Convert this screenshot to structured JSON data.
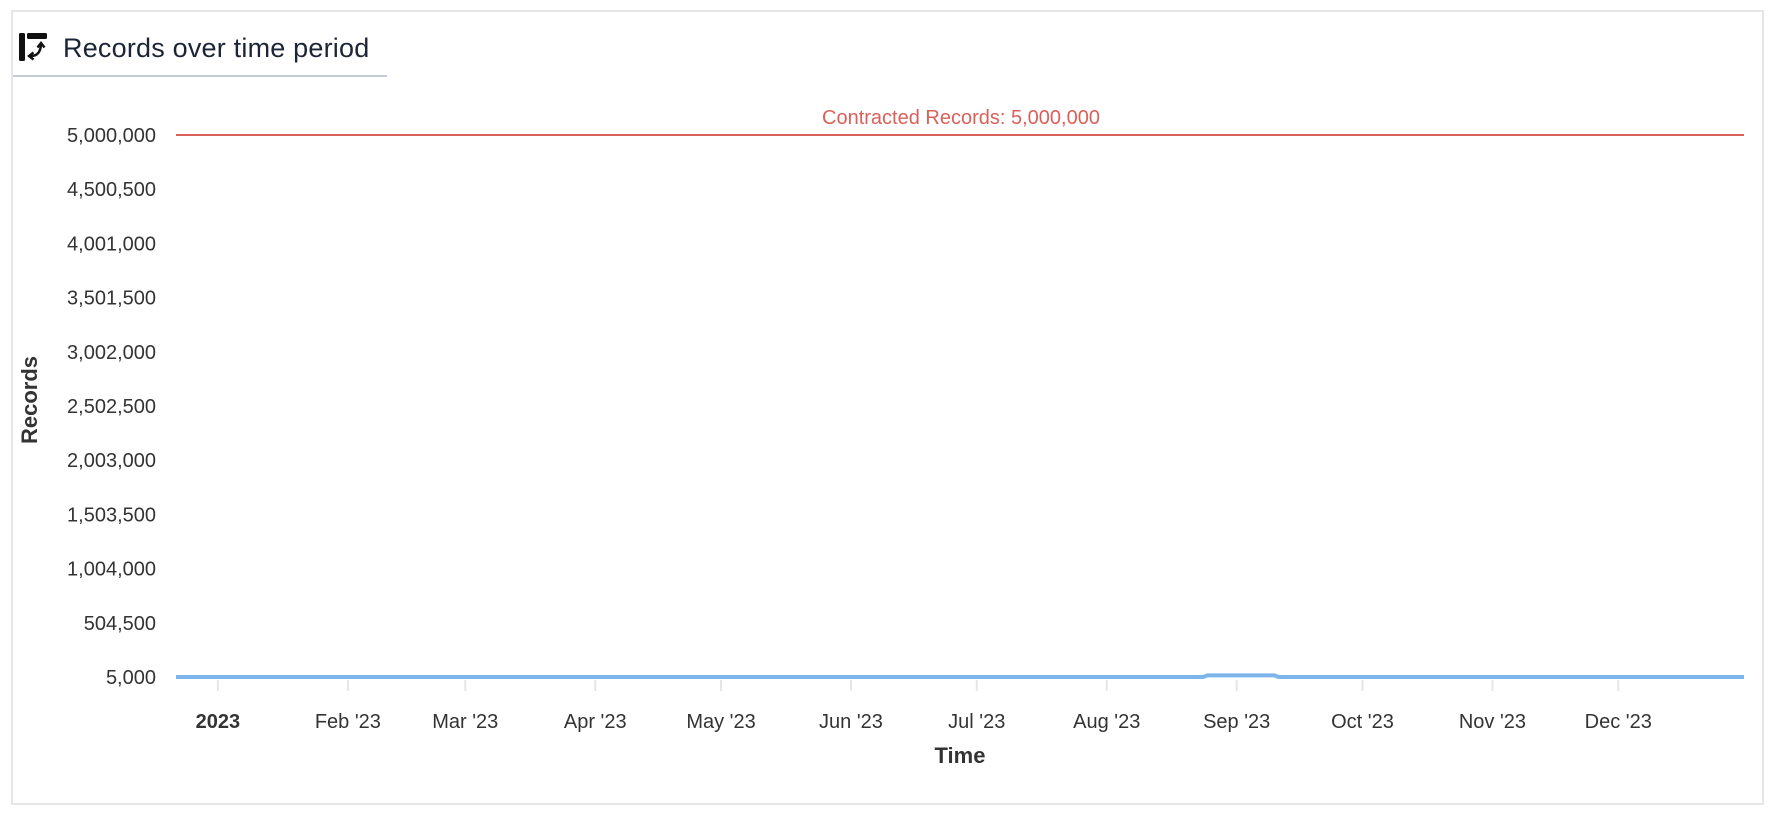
{
  "card": {
    "title": "Records over time period",
    "icon": "pivot-table-icon"
  },
  "colors": {
    "series": "#7cb5ec",
    "threshold": "#d9615a",
    "title_text": "#1c2436",
    "axis_text": "#333333",
    "gridline_tick": "#e6e6e6"
  },
  "chart_data": {
    "type": "line",
    "title": "Records over time period",
    "xlabel": "Time",
    "ylabel": "Records",
    "ylim": [
      5000,
      5000000
    ],
    "y_ticks": [
      5000,
      504500,
      1004000,
      1503500,
      2003000,
      2502500,
      3002000,
      3501500,
      4001000,
      4500500,
      5000000
    ],
    "y_tick_labels": [
      "5,000",
      "504,500",
      "1,004,000",
      "1,503,500",
      "2,003,000",
      "2,502,500",
      "3,002,000",
      "3,501,500",
      "4,001,000",
      "4,500,500",
      "5,000,000"
    ],
    "x_range": [
      "2022-12-22",
      "2023-12-31"
    ],
    "x_ticks": [
      "2023-01-01",
      "2023-02-01",
      "2023-03-01",
      "2023-04-01",
      "2023-05-01",
      "2023-06-01",
      "2023-07-01",
      "2023-08-01",
      "2023-09-01",
      "2023-10-01",
      "2023-11-01",
      "2023-12-01"
    ],
    "x_tick_labels": [
      "2023",
      "Feb '23",
      "Mar '23",
      "Apr '23",
      "May '23",
      "Jun '23",
      "Jul '23",
      "Aug '23",
      "Sep '23",
      "Oct '23",
      "Nov '23",
      "Dec '23"
    ],
    "grid": false,
    "legend": "none",
    "plot_lines": [
      {
        "label": "Contracted Records: 5,000,000",
        "value": 5000000,
        "color": "#d9615a"
      }
    ],
    "series": [
      {
        "name": "Records",
        "color": "#7cb5ec",
        "x": [
          "2022-12-22",
          "2023-08-24",
          "2023-08-25",
          "2023-09-10",
          "2023-09-11",
          "2023-12-31"
        ],
        "values": [
          5000,
          5000,
          20000,
          20000,
          5000,
          5000
        ]
      }
    ]
  }
}
